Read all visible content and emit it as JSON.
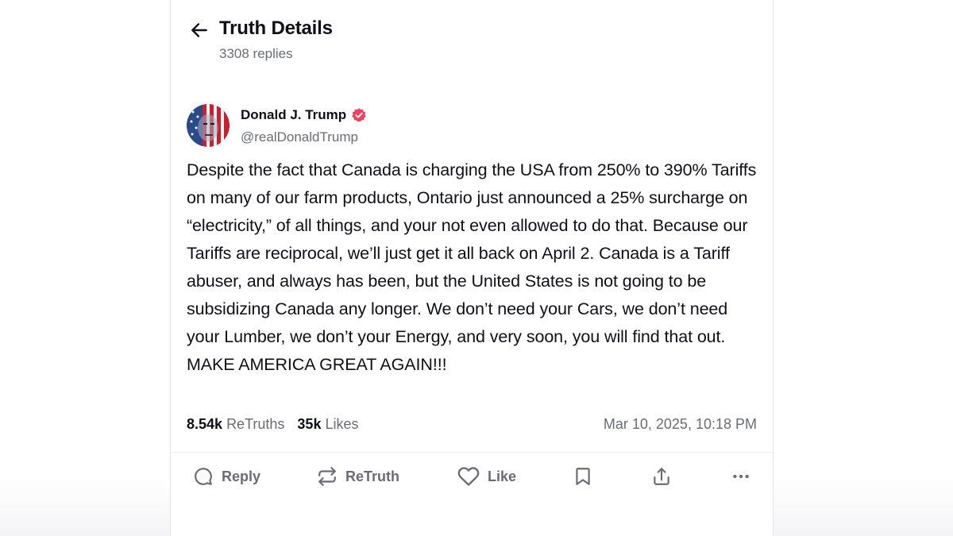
{
  "header": {
    "title": "Truth Details",
    "replies": "3308 replies",
    "back_icon": "arrow-left-icon"
  },
  "author": {
    "name": "Donald J. Trump",
    "handle": "@realDonaldTrump",
    "verified_icon": "verified-badge-icon",
    "verified_color": "#f43f5e"
  },
  "post": {
    "text": "Despite the fact that Canada is charging the USA from 250% to 390% Tariffs on many of our farm products, Ontario just announced a 25% surcharge on “electricity,” of all things, and your not even allowed to do that. Because our Tariffs are reciprocal, we’ll just get it all back on April 2. Canada is a Tariff abuser, and always has been, but the United States is not going to be subsidizing Canada any longer. We don’t need your Cars, we don’t need your Lumber, we don’t your Energy, and very soon, you will find that out. MAKE AMERICA GREAT AGAIN!!!"
  },
  "stats": {
    "retruths_count": "8.54k",
    "retruths_label": "ReTruths",
    "likes_count": "35k",
    "likes_label": "Likes",
    "timestamp": "Mar 10, 2025, 10:18 PM"
  },
  "actions": {
    "reply_label": "Reply",
    "retruth_label": "ReTruth",
    "like_label": "Like",
    "icons": [
      "reply-icon",
      "retruth-icon",
      "like-icon",
      "bookmark-icon",
      "share-icon",
      "more-icon"
    ]
  },
  "colors": {
    "text_primary": "#0f0f1a",
    "text_secondary": "#6b6b78",
    "divider": "#ececf0"
  }
}
